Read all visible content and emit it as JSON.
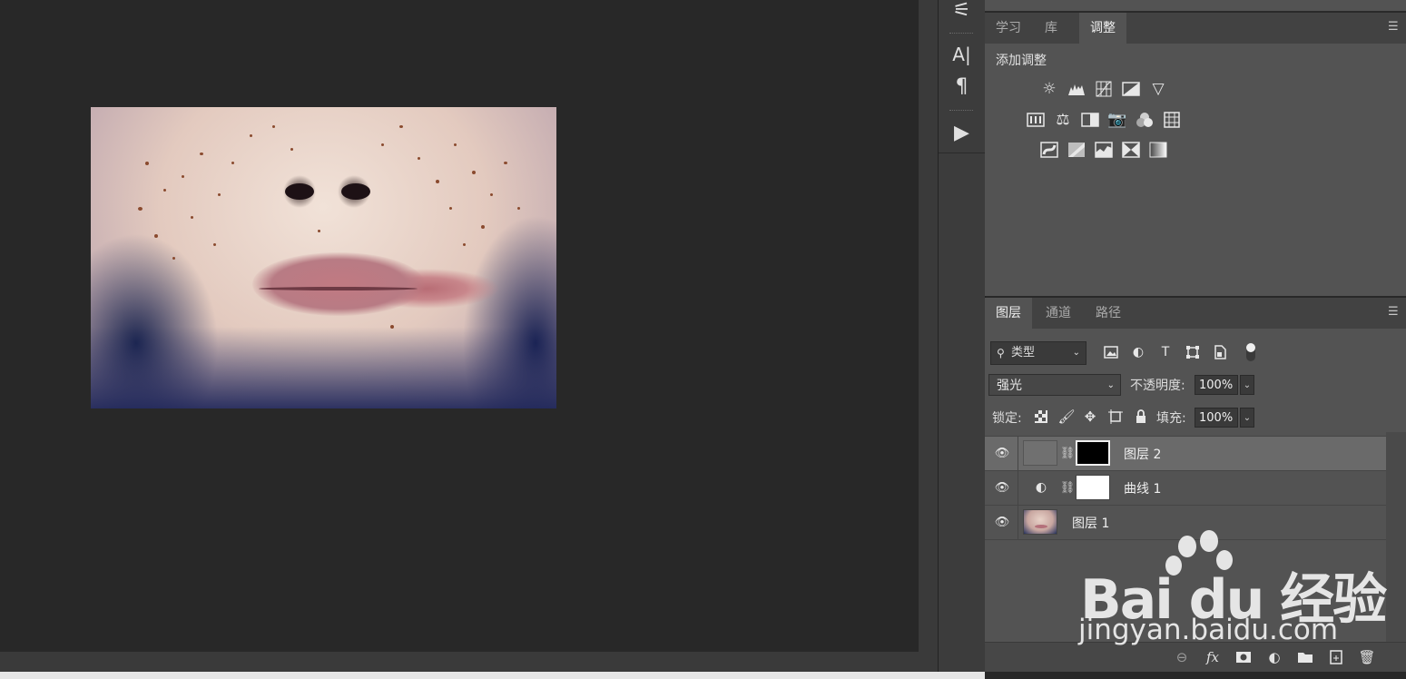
{
  "toolstrip": {
    "tools": [
      {
        "name": "properties-sliders-icon",
        "glyph": "⚟"
      },
      {
        "name": "character-text-icon",
        "glyph": "A|"
      },
      {
        "name": "paragraph-icon",
        "glyph": "¶"
      },
      {
        "name": "actions-play-icon",
        "glyph": "▶"
      }
    ]
  },
  "adjustments_panel": {
    "tabs": [
      "学习",
      "库",
      "调整"
    ],
    "active_tab": "调整",
    "title": "添加调整",
    "icon_rows": [
      [
        "brightness-contrast",
        "levels",
        "curves",
        "exposure",
        "vibrance"
      ],
      [
        "hue-saturation",
        "color-balance",
        "black-white",
        "photo-filter",
        "channel-mixer",
        "color-lookup"
      ],
      [
        "invert",
        "posterize",
        "threshold",
        "selective-color",
        "gradient-map"
      ]
    ]
  },
  "layers_panel": {
    "tabs": [
      "图层",
      "通道",
      "路径"
    ],
    "active_tab": "图层",
    "filter_kind": "类型",
    "blend_mode": "强光",
    "opacity_label": "不透明度:",
    "opacity_value": "100%",
    "lock_label": "锁定:",
    "fill_label": "填充:",
    "fill_value": "100%",
    "layers": [
      {
        "name": "图层 2",
        "selected": true,
        "type": "pixel-with-mask"
      },
      {
        "name": "曲线 1",
        "selected": false,
        "type": "adjustment"
      },
      {
        "name": "图层 1",
        "selected": false,
        "type": "image"
      }
    ]
  },
  "watermark": {
    "logo": "Bai du 经验",
    "url": "jingyan.baidu.com"
  },
  "colors": {
    "canvas_bg": "#282828",
    "panel_bg": "#535353",
    "selected_row": "#6a6a6a"
  }
}
